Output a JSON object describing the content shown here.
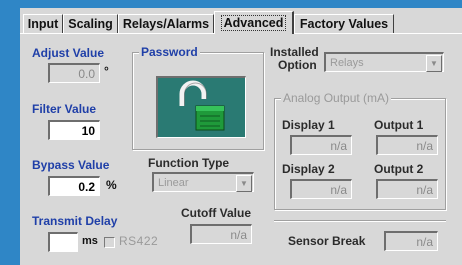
{
  "tabs": [
    {
      "label": "Input"
    },
    {
      "label": "Scaling"
    },
    {
      "label": "Relays/Alarms"
    },
    {
      "label": "Advanced"
    },
    {
      "label": "Factory Values"
    }
  ],
  "adjust_value": {
    "label": "Adjust Value",
    "value": "0.0",
    "unit": "°"
  },
  "filter_value": {
    "label": "Filter Value",
    "value": "10"
  },
  "bypass_value": {
    "label": "Bypass Value",
    "value": "0.2",
    "unit": "%"
  },
  "transmit_delay": {
    "label": "Transmit Delay",
    "value": "",
    "unit": "ms",
    "rs422_label": "RS422"
  },
  "password": {
    "title": "Password",
    "icon": "unlocked-padlock-icon"
  },
  "function_type": {
    "label": "Function Type",
    "selected": "Linear"
  },
  "cutoff_value": {
    "label": "Cutoff Value",
    "value": "n/a"
  },
  "installed_option": {
    "label_line1": "Installed",
    "label_line2": "Option",
    "selected": "Relays"
  },
  "analog_output": {
    "title": "Analog Output (mA)",
    "display1_label": "Display 1",
    "display1_value": "n/a",
    "output1_label": "Output 1",
    "output1_value": "n/a",
    "display2_label": "Display 2",
    "display2_value": "n/a",
    "output2_label": "Output 2",
    "output2_value": "n/a"
  },
  "sensor_break": {
    "label": "Sensor Break",
    "value": "n/a"
  },
  "colors": {
    "background": "#2f86c6",
    "dialog": "#d8d8d8",
    "label_blue": "#1f3fa8",
    "lock_green": "#1f9a3a"
  }
}
